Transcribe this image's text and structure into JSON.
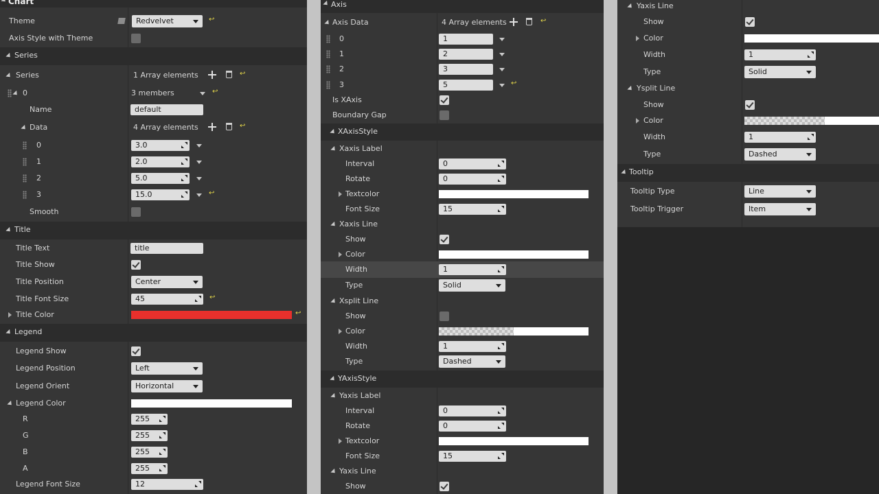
{
  "left": {
    "chart_header": "Chart",
    "theme_label": "Theme",
    "theme_value": "Redvelvet",
    "axis_style_label": "Axis Style with Theme",
    "series_section": "Series",
    "series_label": "Series",
    "series_count": "1 Array elements",
    "series_item_index": "0",
    "series_item_members": "3 members",
    "name_label": "Name",
    "name_value": "default",
    "data_label": "Data",
    "data_count": "4 Array elements",
    "data_items": [
      {
        "index": "0",
        "value": "3.0"
      },
      {
        "index": "1",
        "value": "2.0"
      },
      {
        "index": "2",
        "value": "5.0"
      },
      {
        "index": "3",
        "value": "15.0"
      }
    ],
    "smooth_label": "Smooth",
    "title_section": "Title",
    "title_text_label": "Title Text",
    "title_text_value": "title",
    "title_show_label": "Title Show",
    "title_position_label": "Title Position",
    "title_position_value": "Center",
    "title_font_size_label": "Title Font Size",
    "title_font_size_value": "45",
    "title_color_label": "Title Color",
    "title_color": "#e8302c",
    "legend_section": "Legend",
    "legend_show_label": "Legend Show",
    "legend_position_label": "Legend Position",
    "legend_position_value": "Left",
    "legend_orient_label": "Legend Orient",
    "legend_orient_value": "Horizontal",
    "legend_color_label": "Legend Color",
    "legend_rgba": [
      {
        "label": "R",
        "value": "255"
      },
      {
        "label": "G",
        "value": "255"
      },
      {
        "label": "B",
        "value": "255"
      },
      {
        "label": "A",
        "value": "255"
      }
    ],
    "legend_font_size_label": "Legend Font Size",
    "legend_font_size_value": "12"
  },
  "mid": {
    "axis_section": "Axis",
    "axis_data_label": "Axis Data",
    "axis_data_count": "4 Array elements",
    "axis_items": [
      {
        "index": "0",
        "value": "1"
      },
      {
        "index": "1",
        "value": "2"
      },
      {
        "index": "2",
        "value": "3"
      },
      {
        "index": "3",
        "value": "5"
      }
    ],
    "is_xaxis_label": "Is XAxis",
    "boundary_gap_label": "Boundary Gap",
    "xaxis_style_section": "XAxisStyle",
    "xaxis_label_group": "Xaxis Label",
    "interval_label": "Interval",
    "x_interval_value": "0",
    "rotate_label": "Rotate",
    "x_rotate_value": "0",
    "textcolor_label": "Textcolor",
    "font_size_label": "Font Size",
    "x_font_size_value": "15",
    "xaxis_line_group": "Xaxis Line",
    "show_label": "Show",
    "color_label": "Color",
    "width_label": "Width",
    "x_line_width_value": "1",
    "type_label": "Type",
    "x_line_type_value": "Solid",
    "xsplit_line_group": "Xsplit Line",
    "x_split_width_value": "1",
    "x_split_type_value": "Dashed",
    "yaxis_style_section": "YAxisStyle",
    "yaxis_label_group": "Yaxis Label",
    "y_interval_value": "0",
    "y_rotate_value": "0",
    "y_font_size_value": "15",
    "yaxis_line_group": "Yaxis Line"
  },
  "right": {
    "yaxis_line_group": "Yaxis Line",
    "show_label": "Show",
    "color_label": "Color",
    "width_label": "Width",
    "y_line_width_value": "1",
    "type_label": "Type",
    "y_line_type_value": "Solid",
    "ysplit_line_group": "Ysplit Line",
    "y_split_width_value": "1",
    "y_split_type_value": "Dashed",
    "tooltip_section": "Tooltip",
    "tooltip_type_label": "Tooltip Type",
    "tooltip_type_value": "Line",
    "tooltip_trigger_label": "Tooltip Trigger",
    "tooltip_trigger_value": "Item"
  }
}
